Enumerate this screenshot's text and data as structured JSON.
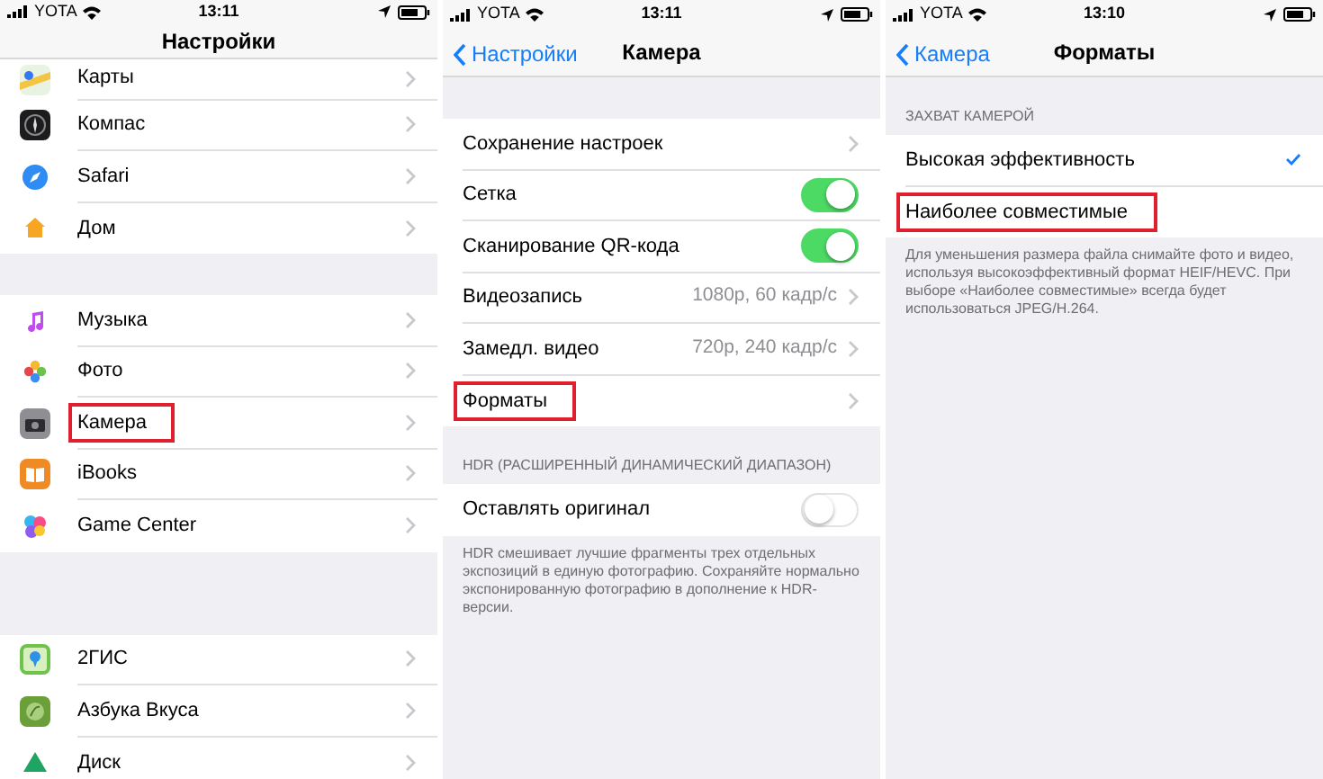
{
  "screens": [
    {
      "status_bar": {
        "carrier": "YOTA",
        "time": "13:11"
      },
      "nav": {
        "title": "Настройки"
      },
      "sections": [
        {
          "rows": [
            {
              "kind": "app",
              "label": "Карты",
              "highlighted": false
            },
            {
              "kind": "app",
              "label": "Компас",
              "highlighted": false
            },
            {
              "kind": "app",
              "label": "Safari",
              "highlighted": false
            },
            {
              "kind": "app",
              "label": "Дом",
              "highlighted": false
            }
          ]
        },
        {
          "rows": [
            {
              "kind": "app",
              "label": "Музыка",
              "highlighted": false
            },
            {
              "kind": "app",
              "label": "Фото",
              "highlighted": false
            },
            {
              "kind": "app",
              "label": "Камера",
              "highlighted": true
            },
            {
              "kind": "app",
              "label": "iBooks",
              "highlighted": false
            },
            {
              "kind": "app",
              "label": "Game Center",
              "highlighted": false
            }
          ]
        },
        {
          "rows": [
            {
              "kind": "app",
              "label": "2ГИС",
              "highlighted": false
            },
            {
              "kind": "app",
              "label": "Азбука Вкуса",
              "highlighted": false
            },
            {
              "kind": "app",
              "label": "Диск",
              "highlighted": false
            }
          ]
        }
      ]
    },
    {
      "status_bar": {
        "carrier": "YOTA",
        "time": "13:11"
      },
      "nav": {
        "back": "Настройки",
        "title": "Камера"
      },
      "sections": [
        {
          "rows": [
            {
              "kind": "link",
              "label": "Сохранение настроек",
              "highlighted": false
            },
            {
              "kind": "toggle",
              "label": "Сетка",
              "on": true,
              "highlighted": false
            },
            {
              "kind": "toggle",
              "label": "Сканирование QR-кода",
              "on": true,
              "highlighted": false
            },
            {
              "kind": "value",
              "label": "Видеозапись",
              "value": "1080p, 60 кадр/с",
              "highlighted": false
            },
            {
              "kind": "value",
              "label": "Замедл. видео",
              "value": "720p, 240 кадр/с",
              "highlighted": false
            },
            {
              "kind": "link",
              "label": "Форматы",
              "highlighted": true
            }
          ]
        },
        {
          "header": "HDR (РАСШИРЕННЫЙ ДИНАМИЧЕСКИЙ ДИАПАЗОН)",
          "rows": [
            {
              "kind": "toggle",
              "label": "Оставлять оригинал",
              "on": false,
              "highlighted": false
            }
          ],
          "footer": "HDR смешивает лучшие фрагменты трех отдельных экспозиций в единую фотографию. Сохраняйте нормально экспонированную фотографию в дополнение к HDR-версии."
        }
      ]
    },
    {
      "status_bar": {
        "carrier": "YOTA",
        "time": "13:10"
      },
      "nav": {
        "back": "Камера",
        "title": "Форматы"
      },
      "sections": [
        {
          "header": "ЗАХВАТ КАМЕРОЙ",
          "rows": [
            {
              "kind": "check",
              "label": "Высокая эффективность",
              "checked": true,
              "highlighted": false
            },
            {
              "kind": "check",
              "label": "Наиболее совместимые",
              "checked": false,
              "highlighted": true
            }
          ],
          "footer": "Для уменьшения размера файла снимайте фото и видео, используя высокоэффективный формат HEIF/HEVC. При выборе «Наиболее совместимые» всегда будет использоваться JPEG/H.264."
        }
      ]
    }
  ]
}
